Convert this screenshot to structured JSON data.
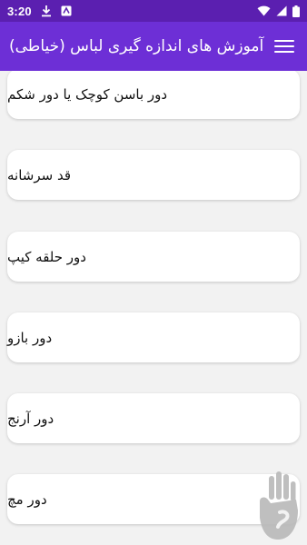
{
  "status_bar": {
    "time": "3:20",
    "icons": [
      "download-icon",
      "notification-icon",
      "wifi-icon",
      "signal-icon",
      "battery-icon"
    ]
  },
  "app_bar": {
    "title": "آموزش های اندازه گیری لباس (خیاطی)",
    "menu_icon": "hamburger-menu-icon"
  },
  "list": {
    "items": [
      {
        "label": "دور باسن کوچک یا دور شکم"
      },
      {
        "label": "قد سرشانه"
      },
      {
        "label": "دور حلقه کیپ"
      },
      {
        "label": "دور بازو"
      },
      {
        "label": "دور آرنج"
      },
      {
        "label": "دور مچ"
      }
    ]
  },
  "colors": {
    "status_bar": "#5b1fb0",
    "app_bar": "#6d2fd6",
    "background": "#f2f2f2",
    "card": "#ffffff"
  }
}
